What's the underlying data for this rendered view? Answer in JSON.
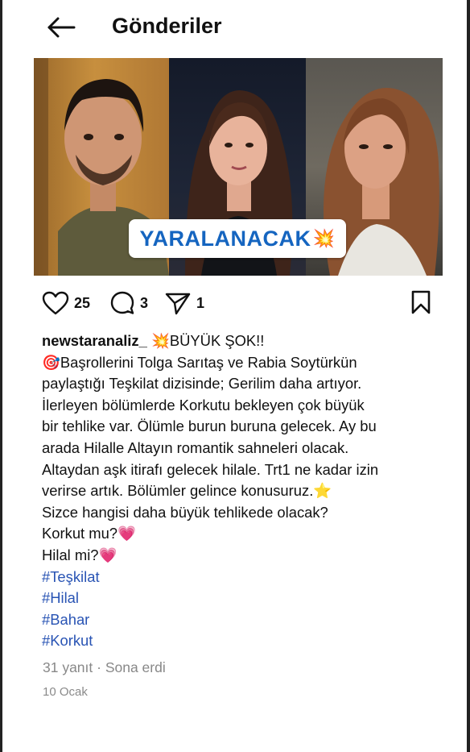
{
  "header": {
    "title": "Gönderiler",
    "back_icon": "arrow-left-icon"
  },
  "media": {
    "overlay_text": "YARALANACAK",
    "overlay_emoji": "💥"
  },
  "actions": {
    "likes": "25",
    "comments": "3",
    "shares": "1"
  },
  "post": {
    "username": "newstaranaliz_",
    "headline": "💥BÜYÜK ŞOK!!",
    "lines": [
      "🎯Başrollerini Tolga Sarıtaş ve Rabia Soytürkün",
      "paylaştığı Teşkilat dizisinde; Gerilim daha artıyor.",
      "İlerleyen bölümlerde Korkutu bekleyen çok büyük",
      "bir tehlike var. Ölümle burun buruna gelecek. Ay bu",
      "arada Hilalle Altayın romantik sahneleri olacak.",
      "Altaydan aşk itirafı gelecek hilale. Trt1 ne kadar izin",
      "verirse artık. Bölümler gelince konusuruz.⭐",
      "Sizce hangisi daha büyük tehlikede olacak?",
      "Korkut mu?💗",
      "Hilal mi?💗"
    ],
    "hashtags": [
      "#Teşkilat",
      "#Hilal",
      "#Bahar",
      "#Korkut"
    ]
  },
  "footer": {
    "replies": "31 yanıt · Sona erdi",
    "date": "10 Ocak"
  }
}
